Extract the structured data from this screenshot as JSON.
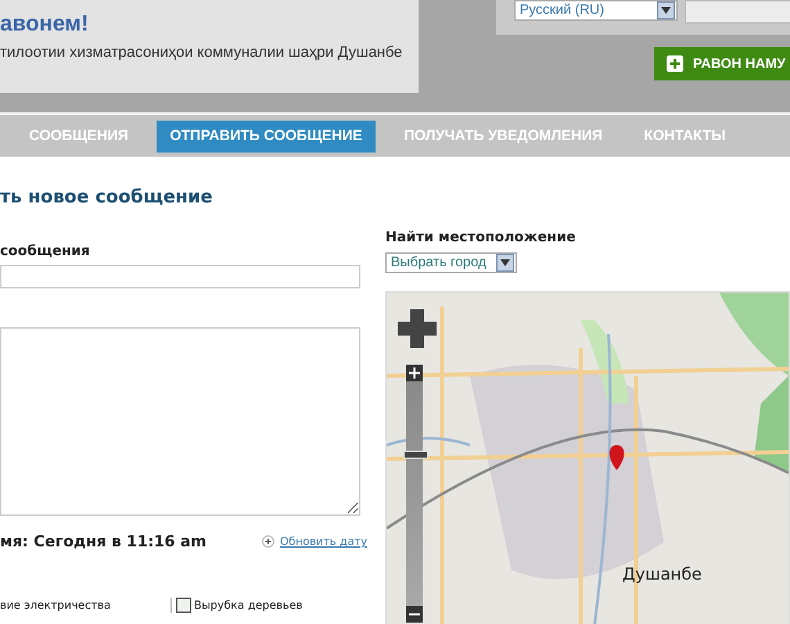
{
  "header": {
    "welcome": "авонем!",
    "subtitle": "тилоотии хизматрасониҳои коммуналии шаҳри Душанбе"
  },
  "language_select": {
    "value": "Русский (RU)"
  },
  "report_button": {
    "label": "РАВОН НАМУ"
  },
  "nav": [
    {
      "label": "СООБЩЕНИЯ",
      "selected": false
    },
    {
      "label": "ОТПРАВИТЬ СООБЩЕНИЕ",
      "selected": true
    },
    {
      "label": "ПОЛУЧАТЬ УВЕДОМЛЕНИЯ",
      "selected": false
    },
    {
      "label": "КОНТАКТЫ",
      "selected": false
    }
  ],
  "page_title": "ть новое сообщение",
  "form": {
    "title_label": "сообщения",
    "time_label": "мя: Сегодня в 11:16 am",
    "update_link": "Обновить дату",
    "categories": [
      {
        "label": "вие электричества",
        "kind": "text"
      },
      {
        "label": "Вырубка деревьев",
        "kind": "checkbox",
        "checked": false
      }
    ]
  },
  "location": {
    "label": "Найти местоположение",
    "city_select": "Выбрать город",
    "map": {
      "kind": "picture",
      "city_label": "Душанбе",
      "zoom": {
        "level": 0.67
      }
    }
  }
}
